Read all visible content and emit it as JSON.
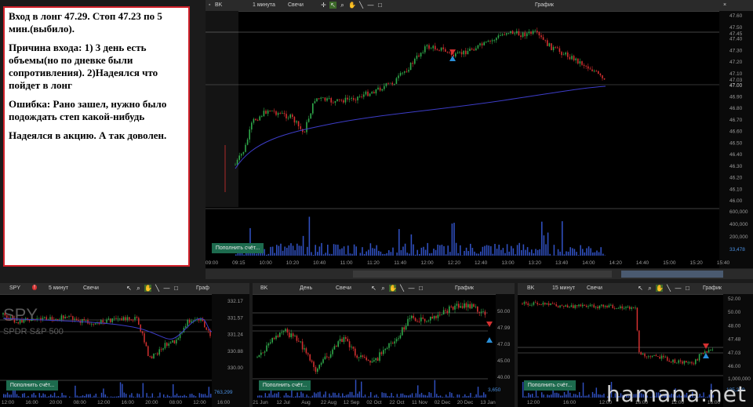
{
  "note": {
    "line1": "Вход в лонг 47.29. Стоп 47.23 по 5 мин.(выбило).",
    "line2": "Причина входа: 1) 3 день есть объемы(но по дневке были сопротивления). 2)Надеялся что пойдет в лонг",
    "line3": "Ошибка: Рано зашел, нужно было подождать степ какой-нибудь",
    "line4": "Надеялся в акцию. А так доволен."
  },
  "main": {
    "symbol": "BK",
    "interval": "1 минута",
    "type": "Свечи",
    "title": "График",
    "button": "Пополнить счёт...",
    "volume_label": "33,478",
    "y_ticks": [
      "47.60",
      "47.50",
      "47.40",
      "47.30",
      "47.20",
      "47.10",
      "47.00",
      "46.90",
      "46.80",
      "46.70",
      "46.60",
      "46.50",
      "46.40",
      "46.30",
      "46.20",
      "46.10",
      "46.00"
    ],
    "price_tags": [
      "47.45",
      "47.03",
      "47.00"
    ],
    "vol_ticks": [
      "600,000",
      "400,000",
      "200,000"
    ],
    "x_ticks": [
      "09:00",
      "09:15",
      "10:00",
      "10:20",
      "10:40",
      "11:00",
      "11:20",
      "11:40",
      "12:00",
      "12:20",
      "12:40",
      "13:00",
      "13:20",
      "13:40",
      "14:00",
      "14:20",
      "14:40",
      "15:00",
      "15:20",
      "15:40"
    ]
  },
  "spy": {
    "symbol": "SPY",
    "interval": "5 минут",
    "type": "Свечи",
    "title": "Граф",
    "ghost": "SPY",
    "ghost_sub": "SPDR S&P 500",
    "button": "Пополнить счёт...",
    "volume_label": "763,299",
    "y_ticks": [
      "332.17",
      "331.57",
      "331.24",
      "330.88",
      "330.00"
    ],
    "x_ticks": [
      "12:00",
      "16:00",
      "20:00",
      "08:00",
      "12:00",
      "16:00",
      "20:00",
      "08:00",
      "12:00",
      "16:00"
    ]
  },
  "daily": {
    "symbol": "BK",
    "interval": "День",
    "type": "Свечи",
    "title": "График",
    "button": "Пополнить счёт...",
    "volume_label": "3,650",
    "y_ticks": [
      "50.00",
      "47.99",
      "47.03",
      "45.00",
      "40.00"
    ],
    "x_ticks": [
      "21 Jun",
      "12 Jul",
      "Aug",
      "22 Aug",
      "12 Sep",
      "02 Oct",
      "22 Oct",
      "11 Nov",
      "02 Dec",
      "20 Dec",
      "13 Jan"
    ]
  },
  "m15": {
    "symbol": "BK",
    "interval": "15 минут",
    "type": "Свечи",
    "title": "График",
    "button": "Пополнить счёт...",
    "volume_label": "125,250",
    "y_ticks": [
      "52.00",
      "50.00",
      "48.00",
      "47.48",
      "47.03",
      "46.00"
    ],
    "vol_tick": "1,000,000",
    "x_ticks": [
      "12:00",
      "16:00",
      "12:00",
      "16:00",
      "12:00",
      "16:00"
    ]
  },
  "watermark": "hamana.net",
  "colors": {
    "up": "#2fa84a",
    "down": "#d33030",
    "ma": "#3d3dc8",
    "accent": "#1d6b4e"
  }
}
